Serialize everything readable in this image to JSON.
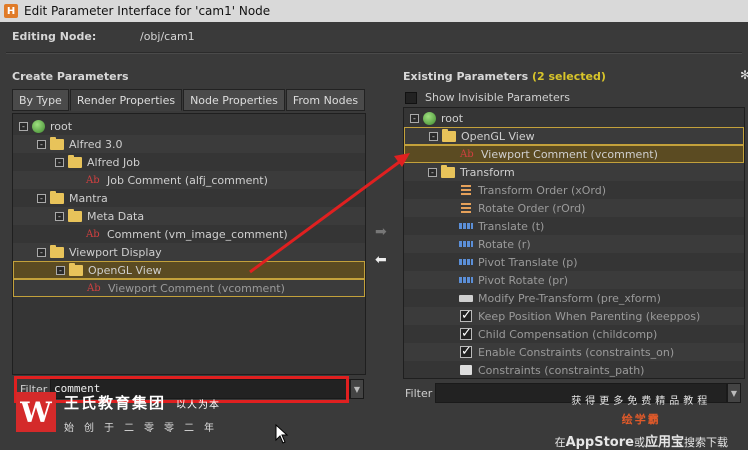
{
  "window": {
    "title": "Edit Parameter Interface for 'cam1' Node",
    "app_icon": "houdini-icon"
  },
  "editing": {
    "label": "Editing Node:",
    "value": "/obj/cam1"
  },
  "left": {
    "title": "Create Parameters",
    "tabs": [
      "By Type",
      "Render Properties",
      "Node Properties",
      "From Nodes"
    ],
    "active_tab": "Render Properties",
    "tree": [
      {
        "label": "root",
        "icon": "globe-icon",
        "indent": 0,
        "toggle": "-"
      },
      {
        "label": "Alfred 3.0",
        "icon": "folder-icon",
        "indent": 1,
        "toggle": "-"
      },
      {
        "label": "Alfred Job",
        "icon": "folder-icon",
        "indent": 2,
        "toggle": "-"
      },
      {
        "label": "Job Comment (alfj_comment)",
        "icon": "string-param-icon",
        "indent": 3
      },
      {
        "label": "Mantra",
        "icon": "folder-icon",
        "indent": 1,
        "toggle": "-"
      },
      {
        "label": "Meta Data",
        "icon": "folder-icon",
        "indent": 2,
        "toggle": "-"
      },
      {
        "label": "Comment (vm_image_comment)",
        "icon": "string-param-icon",
        "indent": 3
      },
      {
        "label": "Viewport Display",
        "icon": "folder-icon",
        "indent": 1,
        "toggle": "-"
      },
      {
        "label": "OpenGL View",
        "icon": "folder-icon",
        "indent": 2,
        "toggle": "-",
        "highlight": true
      },
      {
        "label": "Viewport Comment (vcomment)",
        "icon": "string-param-icon",
        "indent": 3,
        "highlight": true,
        "dim": true
      }
    ],
    "filter": {
      "label": "Filter",
      "value": "comment"
    }
  },
  "right": {
    "title": "Existing Parameters",
    "selected_count": "(2 selected)",
    "show_invisible_label": "Show Invisible Parameters",
    "tree": [
      {
        "label": "root",
        "icon": "globe-icon",
        "indent": 0,
        "toggle": "-"
      },
      {
        "label": "OpenGL View",
        "icon": "folder-icon",
        "indent": 1,
        "toggle": "-",
        "highlight": true
      },
      {
        "label": "Viewport Comment (vcomment)",
        "icon": "string-param-icon",
        "indent": 2,
        "highlight": true
      },
      {
        "label": "Transform",
        "icon": "folder-icon",
        "indent": 1,
        "toggle": "-"
      },
      {
        "label": "Transform Order (xOrd)",
        "icon": "menu-param-icon",
        "indent": 2,
        "dim": true
      },
      {
        "label": "Rotate Order (rOrd)",
        "icon": "menu-param-icon",
        "indent": 2,
        "dim": true
      },
      {
        "label": "Translate (t)",
        "icon": "vector-param-icon",
        "indent": 2,
        "dim": true
      },
      {
        "label": "Rotate (r)",
        "icon": "vector-param-icon",
        "indent": 2,
        "dim": true
      },
      {
        "label": "Pivot Translate (p)",
        "icon": "vector-param-icon",
        "indent": 2,
        "dim": true
      },
      {
        "label": "Pivot Rotate (pr)",
        "icon": "vector-param-icon",
        "indent": 2,
        "dim": true
      },
      {
        "label": "Modify Pre-Transform (pre_xform)",
        "icon": "button-param-icon",
        "indent": 2,
        "dim": true
      },
      {
        "label": "Keep Position When Parenting (keeppos)",
        "icon": "toggle-param-icon",
        "indent": 2,
        "dim": true
      },
      {
        "label": "Child Compensation (childcomp)",
        "icon": "toggle-param-icon",
        "indent": 2,
        "dim": true
      },
      {
        "label": "Enable Constraints (constraints_on)",
        "icon": "toggle-param-icon",
        "indent": 2,
        "dim": true
      },
      {
        "label": "Constraints (constraints_path)",
        "icon": "operator-path-icon",
        "indent": 2,
        "dim": true
      }
    ],
    "filter": {
      "label": "Filter",
      "value": ""
    }
  },
  "overlay": {
    "brand_name": "王氏教育集团",
    "brand_slogan": "以人为本",
    "brand_tagline": "始创于二零零二年",
    "promo_line1": "获得更多免费精品教程",
    "promo_app": "绘学霸",
    "promo_line3_a": "在",
    "promo_line3_b": "AppStore",
    "promo_line3_c": "或",
    "promo_line3_d": "应用宝",
    "promo_line3_e": "搜索下载",
    "highlight_color": "#e02020",
    "selected_color": "#d8c52a"
  }
}
